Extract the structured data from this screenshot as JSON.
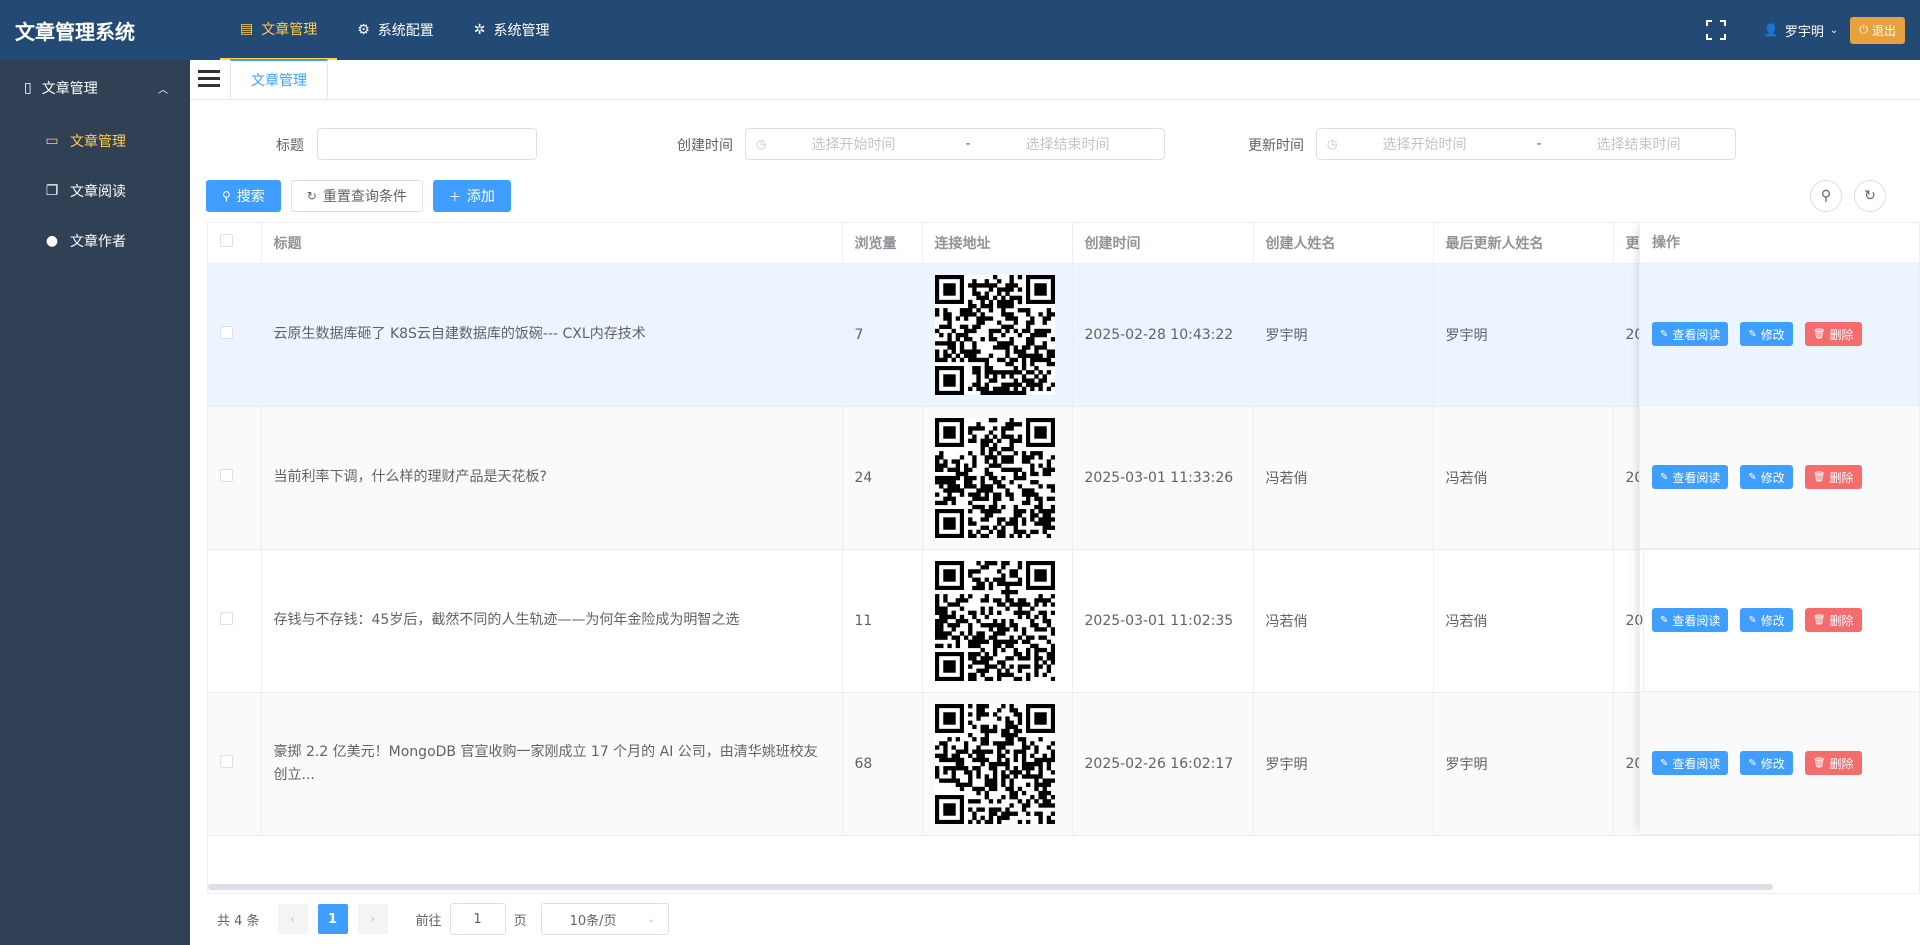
{
  "app": {
    "title": "文章管理系统"
  },
  "topnav": [
    {
      "label": "文章管理",
      "icon": "document-icon",
      "active": true
    },
    {
      "label": "系统配置",
      "icon": "gear-icon",
      "active": false
    },
    {
      "label": "系统管理",
      "icon": "cog-icon",
      "active": false
    }
  ],
  "user": {
    "name": "罗宇明",
    "logout_label": "退出"
  },
  "sidebar": {
    "group_label": "文章管理",
    "items": [
      {
        "label": "文章管理",
        "icon": "message-icon",
        "active": true
      },
      {
        "label": "文章阅读",
        "icon": "book-icon",
        "active": false
      },
      {
        "label": "文章作者",
        "icon": "user-icon",
        "active": false
      }
    ]
  },
  "tabs": [
    {
      "label": "文章管理",
      "active": true
    }
  ],
  "search": {
    "title_label": "标题",
    "title_value": "",
    "created_label": "创建时间",
    "updated_label": "更新时间",
    "start_placeholder": "选择开始时间",
    "end_placeholder": "选择结束时间",
    "range_separator": "-"
  },
  "toolbar": {
    "search_label": "搜索",
    "reset_label": "重置查询条件",
    "add_label": "添加"
  },
  "table": {
    "columns": [
      "标题",
      "浏览量",
      "连接地址",
      "创建时间",
      "创建人姓名",
      "最后更新人姓名",
      "更",
      "操作"
    ],
    "rows": [
      {
        "title": "云原生数据库砸了 K8S云自建数据库的饭碗--- CXL内存技术",
        "views": "7",
        "created": "2025-02-28 10:43:22",
        "creator": "罗宇明",
        "updater": "罗宇明",
        "updated_partial": "20"
      },
      {
        "title": "当前利率下调，什么样的理财产品是天花板?",
        "views": "24",
        "created": "2025-03-01 11:33:26",
        "creator": "冯若俏",
        "updater": "冯若俏",
        "updated_partial": "20"
      },
      {
        "title": "存钱与不存钱：45岁后，截然不同的人生轨迹——为何年金险成为明智之选",
        "views": "11",
        "created": "2025-03-01 11:02:35",
        "creator": "冯若俏",
        "updater": "冯若俏",
        "updated_partial": "20"
      },
      {
        "title": "豪掷 2.2 亿美元！MongoDB 官宣收购一家刚成立 17 个月的 AI 公司，由清华姚班校友创立...",
        "views": "68",
        "created": "2025-02-26 16:02:17",
        "creator": "罗宇明",
        "updater": "罗宇明",
        "updated_partial": "20"
      }
    ],
    "actions": {
      "view_label": "查看阅读",
      "edit_label": "修改",
      "delete_label": "删除"
    }
  },
  "pagination": {
    "total_label": "共 4 条",
    "current_page": "1",
    "goto_prefix": "前往",
    "goto_value": "1",
    "goto_suffix": "页",
    "page_size_label": "10条/页"
  },
  "colors": {
    "navbar": "#234a74",
    "sidebar": "#304156",
    "accent": "#409eff",
    "active_menu": "#ffd04b",
    "danger": "#f56c6c",
    "warning": "#e6a23c"
  }
}
